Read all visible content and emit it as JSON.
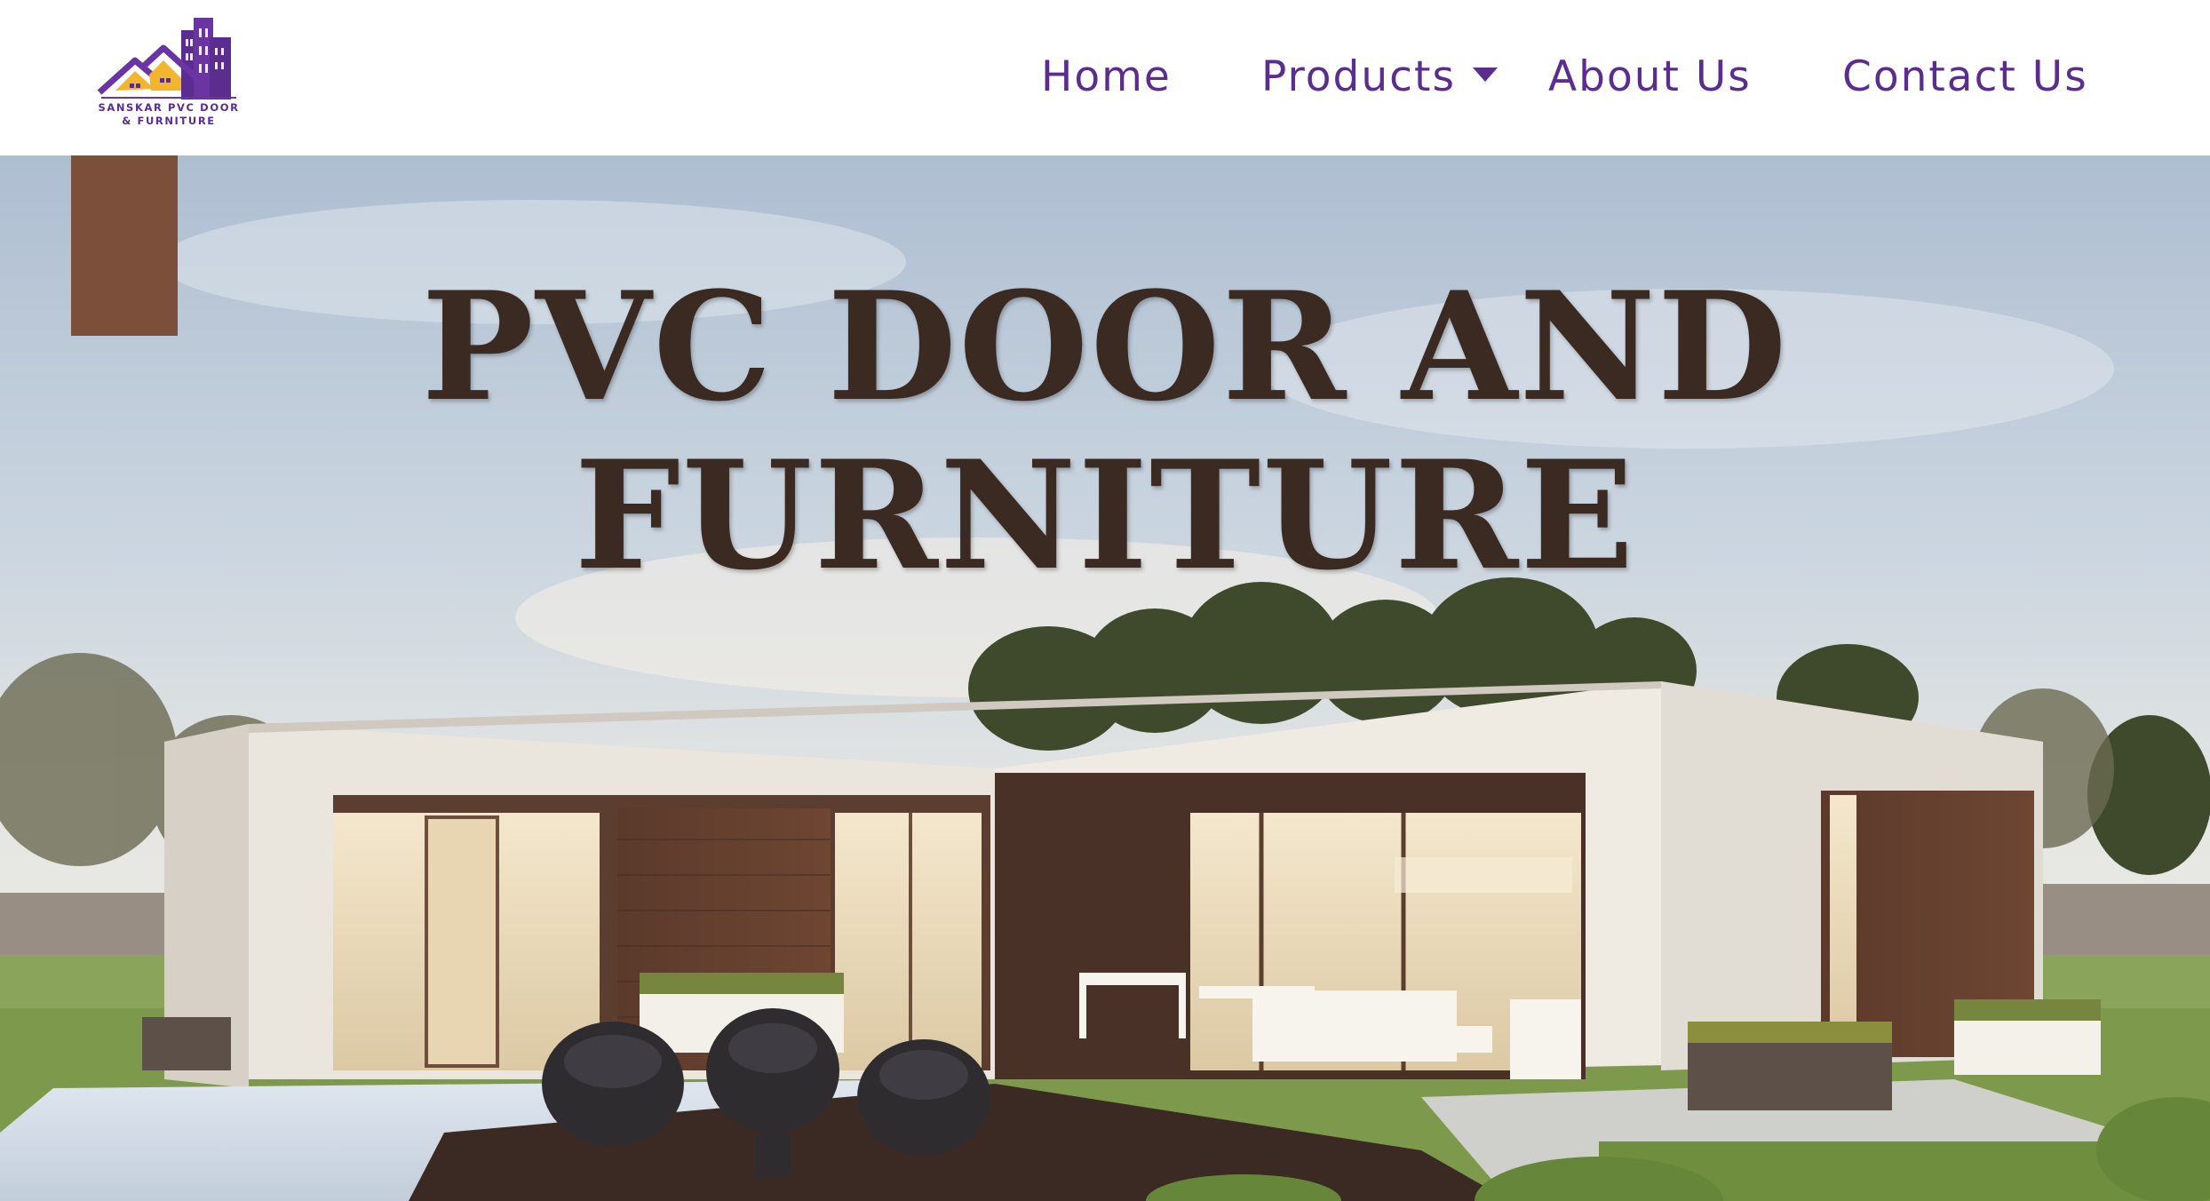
{
  "brand": {
    "name_line1": "SANSKAR PVC DOOR",
    "name_line2": "& FURNITURE",
    "logo_icon": "house-buildings-logo-icon",
    "primary_color": "#5b2d8e",
    "accent_color": "#f2b530"
  },
  "nav": {
    "home": "Home",
    "products": "Products",
    "products_icon": "caret-down-icon",
    "about": "About Us",
    "contact": "Contact Us"
  },
  "hero": {
    "title_line1": "PVC DOOR AND",
    "title_line2": "FURNITURE",
    "accent_block_color": "#7b4f39",
    "background": "modern-house-photo"
  }
}
